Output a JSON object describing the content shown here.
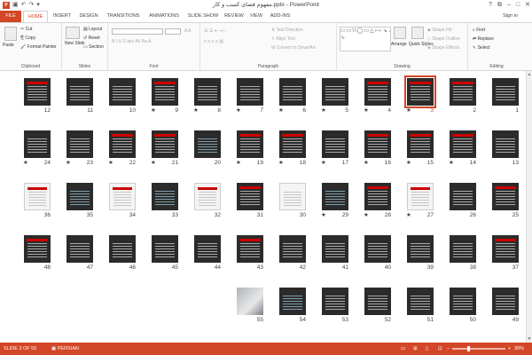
{
  "titlebar": {
    "app_icon": "P",
    "title": "مفهوم فضای کسب و کار.pptx - PowerPoint",
    "qat": [
      "save-icon",
      "undo-icon",
      "redo-icon",
      "customize-icon"
    ],
    "window_controls": [
      "help-icon",
      "restore-ribbon-icon",
      "minimize-icon",
      "maximize-icon",
      "close-icon"
    ]
  },
  "tabs": [
    {
      "label": "FILE",
      "name": "tab-file"
    },
    {
      "label": "HOME",
      "name": "tab-home"
    },
    {
      "label": "INSERT",
      "name": "tab-insert"
    },
    {
      "label": "DESIGN",
      "name": "tab-design"
    },
    {
      "label": "TRANSITIONS",
      "name": "tab-transitions"
    },
    {
      "label": "ANIMATIONS",
      "name": "tab-animations"
    },
    {
      "label": "SLIDE SHOW",
      "name": "tab-slide-show"
    },
    {
      "label": "REVIEW",
      "name": "tab-review"
    },
    {
      "label": "VIEW",
      "name": "tab-view"
    },
    {
      "label": "ADD-INS",
      "name": "tab-add-ins"
    }
  ],
  "signin": "Sign in",
  "ribbon": {
    "clipboard": {
      "label": "Clipboard",
      "paste": "Paste",
      "cut": "Cut",
      "copy": "Copy",
      "format_painter": "Format Painter"
    },
    "slides": {
      "label": "Slides",
      "new_slide": "New Slide",
      "layout": "Layout",
      "reset": "Reset",
      "section": "Section"
    },
    "font": {
      "label": "Font",
      "format_row": "B I U S abc AV Aa A"
    },
    "paragraph": {
      "label": "Paragraph",
      "text_direction": "Text Direction",
      "align_text": "Align Text",
      "convert_smartart": "Convert to SmartArt"
    },
    "drawing": {
      "label": "Drawing",
      "shapes_glyphs": "▭▭\\\\◯▭△⌐⌐↘↔⇨⇩☆{}∿",
      "arrange": "Arrange",
      "quick_styles": "Quick Styles",
      "shape_fill": "Shape Fill",
      "shape_outline": "Shape Outline",
      "shape_effects": "Shape Effects"
    },
    "editing": {
      "label": "Editing",
      "find": "Find",
      "replace": "Replace",
      "select": "Select"
    }
  },
  "slides": [
    {
      "n": "1",
      "star": false,
      "style": "dark",
      "title_band": false
    },
    {
      "n": "2",
      "star": false,
      "style": "dark",
      "title_band": true
    },
    {
      "n": "3",
      "star": true,
      "style": "dark",
      "title_band": true,
      "selected": true
    },
    {
      "n": "4",
      "star": true,
      "style": "dark",
      "title_band": true
    },
    {
      "n": "5",
      "star": true,
      "style": "dark",
      "title_band": false
    },
    {
      "n": "6",
      "star": true,
      "style": "dark",
      "title_band": false
    },
    {
      "n": "7",
      "star": true,
      "style": "dark",
      "title_band": false
    },
    {
      "n": "8",
      "star": true,
      "style": "dark",
      "title_band": false
    },
    {
      "n": "9",
      "star": true,
      "style": "dark",
      "title_band": true
    },
    {
      "n": "10",
      "star": false,
      "style": "dark",
      "title_band": false
    },
    {
      "n": "11",
      "star": false,
      "style": "dark",
      "title_band": false
    },
    {
      "n": "12",
      "star": false,
      "style": "dark",
      "title_band": true
    },
    {
      "n": "13",
      "star": false,
      "style": "dark",
      "title_band": false
    },
    {
      "n": "14",
      "star": true,
      "style": "dark",
      "title_band": true
    },
    {
      "n": "15",
      "star": true,
      "style": "dark",
      "title_band": true
    },
    {
      "n": "16",
      "star": true,
      "style": "dark",
      "title_band": true
    },
    {
      "n": "17",
      "star": true,
      "style": "dark",
      "title_band": false
    },
    {
      "n": "18",
      "star": true,
      "style": "dark",
      "title_band": true
    },
    {
      "n": "19",
      "star": true,
      "style": "dark",
      "title_band": true
    },
    {
      "n": "20",
      "star": false,
      "style": "table",
      "title_band": false
    },
    {
      "n": "21",
      "star": true,
      "style": "dark",
      "title_band": true
    },
    {
      "n": "22",
      "star": true,
      "style": "dark",
      "title_band": true
    },
    {
      "n": "23",
      "star": true,
      "style": "dark",
      "title_band": false
    },
    {
      "n": "24",
      "star": true,
      "style": "dark",
      "title_band": false
    },
    {
      "n": "25",
      "star": false,
      "style": "dark",
      "title_band": true
    },
    {
      "n": "26",
      "star": false,
      "style": "dark",
      "title_band": false
    },
    {
      "n": "27",
      "star": true,
      "style": "light",
      "title_band": true
    },
    {
      "n": "28",
      "star": true,
      "style": "dark",
      "title_band": true
    },
    {
      "n": "29",
      "star": true,
      "style": "table",
      "title_band": false
    },
    {
      "n": "30",
      "star": false,
      "style": "light",
      "title_band": false
    },
    {
      "n": "31",
      "star": false,
      "style": "dark",
      "title_band": true
    },
    {
      "n": "32",
      "star": false,
      "style": "light",
      "title_band": true
    },
    {
      "n": "33",
      "star": false,
      "style": "table",
      "title_band": false
    },
    {
      "n": "34",
      "star": false,
      "style": "light",
      "title_band": true
    },
    {
      "n": "35",
      "star": false,
      "style": "table",
      "title_band": false
    },
    {
      "n": "36",
      "star": false,
      "style": "light",
      "title_band": true
    },
    {
      "n": "37",
      "star": false,
      "style": "dark",
      "title_band": true
    },
    {
      "n": "38",
      "star": false,
      "style": "dark",
      "title_band": false
    },
    {
      "n": "39",
      "star": false,
      "style": "dark",
      "title_band": false
    },
    {
      "n": "40",
      "star": false,
      "style": "dark",
      "title_band": false
    },
    {
      "n": "41",
      "star": false,
      "style": "dark",
      "title_band": false
    },
    {
      "n": "42",
      "star": false,
      "style": "dark",
      "title_band": false
    },
    {
      "n": "43",
      "star": false,
      "style": "dark",
      "title_band": true
    },
    {
      "n": "44",
      "star": false,
      "style": "dark",
      "title_band": false
    },
    {
      "n": "45",
      "star": false,
      "style": "dark",
      "title_band": false
    },
    {
      "n": "46",
      "star": false,
      "style": "dark",
      "title_band": false
    },
    {
      "n": "47",
      "star": false,
      "style": "dark",
      "title_band": false
    },
    {
      "n": "48",
      "star": false,
      "style": "dark",
      "title_band": true
    },
    {
      "n": "49",
      "star": false,
      "style": "dark",
      "title_band": false
    },
    {
      "n": "50",
      "star": false,
      "style": "dark",
      "title_band": false
    },
    {
      "n": "51",
      "star": false,
      "style": "dark",
      "title_band": false
    },
    {
      "n": "52",
      "star": false,
      "style": "dark",
      "title_band": false
    },
    {
      "n": "53",
      "star": false,
      "style": "dark",
      "title_band": false
    },
    {
      "n": "54",
      "star": false,
      "style": "table",
      "title_band": false
    },
    {
      "n": "55",
      "star": false,
      "style": "photo",
      "title_band": false
    }
  ],
  "star_glyph": "★",
  "status": {
    "slide": "SLIDE 3 OF 55",
    "language": "PERSIAN",
    "zoom": "30%",
    "zoom_level": 0.3
  },
  "colors": {
    "accent": "#d24726",
    "thumb_dark": "#2b2b2b",
    "title_band": "#cc0000"
  }
}
